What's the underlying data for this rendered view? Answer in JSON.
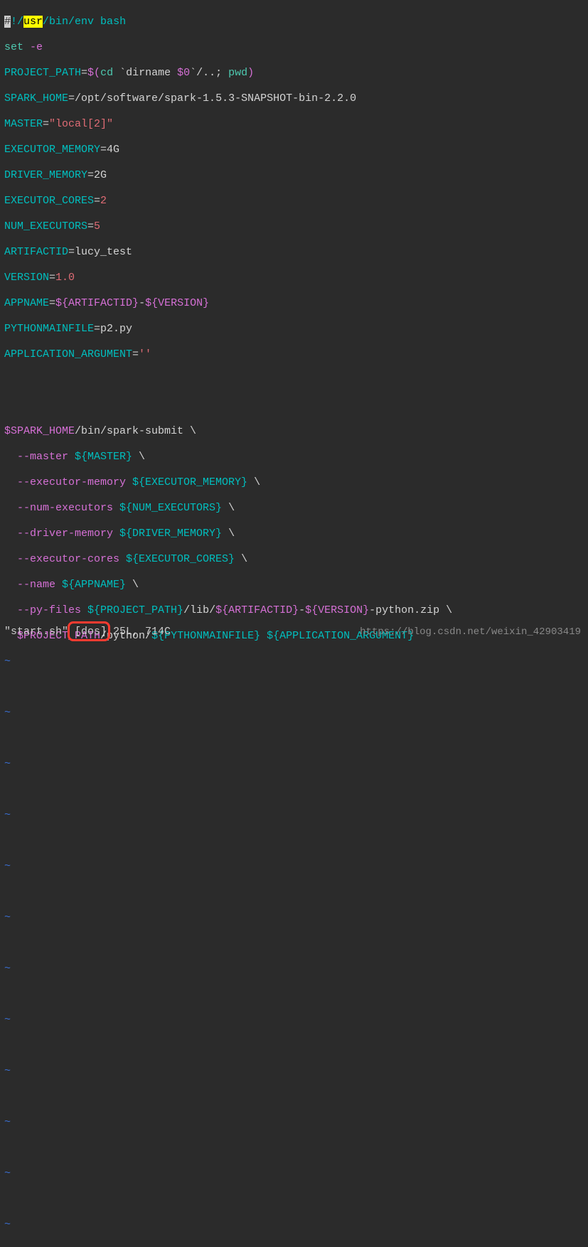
{
  "code": {
    "l1": {
      "a1": "#",
      "a2": "!/",
      "a3": "usr",
      "a4": "/bin/env bash"
    },
    "l2": {
      "a1": "set",
      "a2": " -e"
    },
    "l3": {
      "a1": "PROJECT_PATH",
      "a2": "=",
      "a3": "$(",
      "a4": "cd",
      "a5": " `dirname ",
      "a6": "$0",
      "a7": "`/..; ",
      "a8": "pwd",
      "a9": ")"
    },
    "l4": {
      "a1": "SPARK_HOME",
      "a2": "=",
      "a3": "/opt/software/spark-1.5.3-SNAPSHOT-bin-2.2.0"
    },
    "l5": {
      "a1": "MASTER",
      "a2": "=",
      "a3": "\"local[2]\""
    },
    "l6": {
      "a1": "EXECUTOR_MEMORY",
      "a2": "=",
      "a3": "4G"
    },
    "l7": {
      "a1": "DRIVER_MEMORY",
      "a2": "=",
      "a3": "2G"
    },
    "l8": {
      "a1": "EXECUTOR_CORES",
      "a2": "=",
      "a3": "2"
    },
    "l9": {
      "a1": "NUM_EXECUTORS",
      "a2": "=",
      "a3": "5"
    },
    "l10": {
      "a1": "ARTIFACTID",
      "a2": "=",
      "a3": "lucy_test"
    },
    "l11": {
      "a1": "VERSION",
      "a2": "=",
      "a3": "1.0"
    },
    "l12": {
      "a1": "APPNAME",
      "a2": "=",
      "a3": "${ARTIFACTID}",
      "a4": "-",
      "a5": "${VERSION}"
    },
    "l13": {
      "a1": "PYTHONMAINFILE",
      "a2": "=",
      "a3": "p2.py"
    },
    "l14": {
      "a1": "APPLICATION_ARGUMENT",
      "a2": "=",
      "a3": "''"
    },
    "l15": "",
    "l16": "",
    "l17": {
      "a1": "$SPARK_HOME",
      "a2": "/bin/spark-submit \\"
    },
    "l18": {
      "a1": "  --master ",
      "a2": "${MASTER}",
      "a3": " \\"
    },
    "l19": {
      "a1": "  --executor-memory ",
      "a2": "${EXECUTOR_MEMORY}",
      "a3": " \\"
    },
    "l20": {
      "a1": "  --num-executors ",
      "a2": "${NUM_EXECUTORS}",
      "a3": " \\"
    },
    "l21": {
      "a1": "  --driver-memory ",
      "a2": "${DRIVER_MEMORY}",
      "a3": " \\"
    },
    "l22": {
      "a1": "  --executor-cores ",
      "a2": "${EXECUTOR_CORES}",
      "a3": " \\"
    },
    "l23": {
      "a1": "  --name ",
      "a2": "${APPNAME}",
      "a3": " \\"
    },
    "l24": {
      "a1": "  --py-files ",
      "a2": "${PROJECT_PATH}",
      "a3": "/lib/",
      "a4": "${ARTIFACTID}",
      "a5": "-",
      "a6": "${VERSION}",
      "a7": "-python.zip \\"
    },
    "l25": {
      "a1": "  ",
      "a2": "$PROJECT_PATH",
      "a3": "/python/",
      "a4": "${PYTHONMAINFILE}",
      "a5": " ",
      "a6": "${APPLICATION_ARGUMENT}"
    }
  },
  "tilde": "~",
  "status": {
    "a1": "\"start.sh\" ",
    "a2": "[dos]",
    "a3": " 25L, 714C"
  },
  "watermark": "https://blog.csdn.net/weixin_42903419"
}
